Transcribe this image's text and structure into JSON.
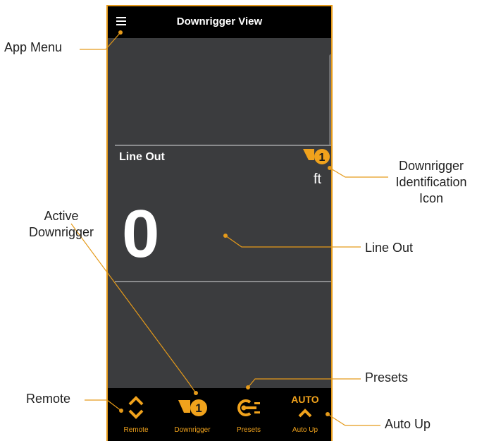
{
  "app": {
    "title": "Downrigger View",
    "menu_icon": "hamburger-menu-icon"
  },
  "main": {
    "line_out_label": "Line Out",
    "downrigger_number": "1",
    "unit": "ft",
    "line_out_value": "0"
  },
  "nav": [
    {
      "label": "Remote",
      "icon": "up-down-chevron-icon"
    },
    {
      "label": "Downrigger",
      "icon": "downrigger-1-icon"
    },
    {
      "label": "Presets",
      "icon": "presets-icon"
    },
    {
      "label": "Auto Up",
      "icon": "chevron-up-icon",
      "badge": "AUTO"
    }
  ],
  "callouts": {
    "app_menu": "App Menu",
    "downrigger_id_1": "Downrigger",
    "downrigger_id_2": "Identification",
    "downrigger_id_3": "Icon",
    "active_downrigger_1": "Active",
    "active_downrigger_2": "Downrigger",
    "line_out": "Line Out",
    "presets": "Presets",
    "remote": "Remote",
    "auto_up": "Auto Up"
  },
  "colors": {
    "accent": "#f0a21c",
    "screen_bg": "#3b3c3e",
    "bar_bg": "#000000",
    "callout_line": "#e59a1a"
  }
}
